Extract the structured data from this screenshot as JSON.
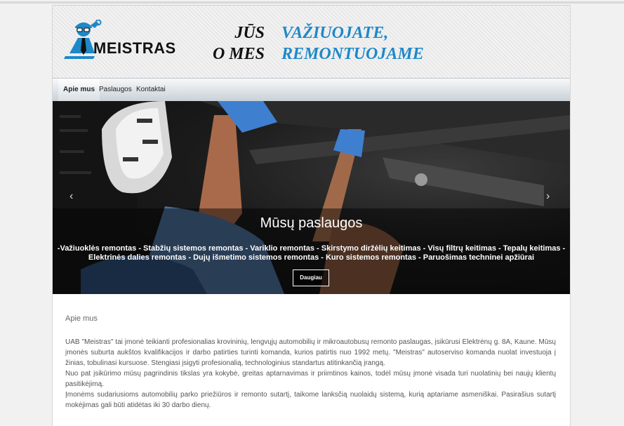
{
  "brand": {
    "name": "MEISTRAS",
    "colors": {
      "accent": "#1e88c8",
      "text_dark": "#111111"
    }
  },
  "slogan": {
    "line1_left": "JŪS",
    "line1_right": "VAŽIUOJATE,",
    "line2_left": "O MES",
    "line2_right": "REMONTUOJAME"
  },
  "nav": {
    "items": [
      {
        "label": "Apie mus",
        "active": true
      },
      {
        "label": "Paslaugos",
        "active": false
      },
      {
        "label": "Kontaktai",
        "active": false
      }
    ]
  },
  "hero": {
    "title": "Mūsų paslaugos",
    "text": "-Važiuoklės remontas - Stabžių sistemos remontas - Variklio remontas - Skirstymo diržėlių keitimas - Visų filtrų keitimas - Tepalų keitimas - Elektrinės dalies remontas - Dujų išmetimo sistemos remontas - Kuro sistemos remontas - Paruošimas techninei apžiūrai",
    "button_label": "Daugiau",
    "prev_icon": "chevron-left-icon",
    "next_icon": "chevron-right-icon"
  },
  "about": {
    "title": "Apie mus",
    "paragraphs": [
      "UAB \"Meistras\" tai įmonė teikianti profesionalias krovininių, lengvųjų automobilių ir mikroautobusų remonto paslaugas, įsikūrusi Elektrėnų g. 8A, Kaune. Mūsų įmonės suburta aukštos kvalifikacijos ir darbo patirties turinti komanda, kurios patirtis nuo 1992 metų. \"Meistras\" autoserviso komanda nuolat investuoja į žinias, tobulinasi kursuose. Stengiasi įsigyti profesionalią, technologinius standartus atitinkančią įrangą.",
      "Nuo pat įsikūrimo mūsų pagrindinis tikslas yra kokybė, greitas aptarnavimas ir priimtinos kainos, todėl mūsų įmonė visada turi nuolatinių bei naujų klientų pasitikėjimą.",
      "Įmonėms sudariusioms automobilių parko priežiūros ir remonto sutartį, taikome lanksčią nuolaidų sistemą, kurią aptariame asmeniškai. Pasirašius sutartį mokėjimas gali būti atidėtas iki 30 darbo dienų."
    ]
  }
}
